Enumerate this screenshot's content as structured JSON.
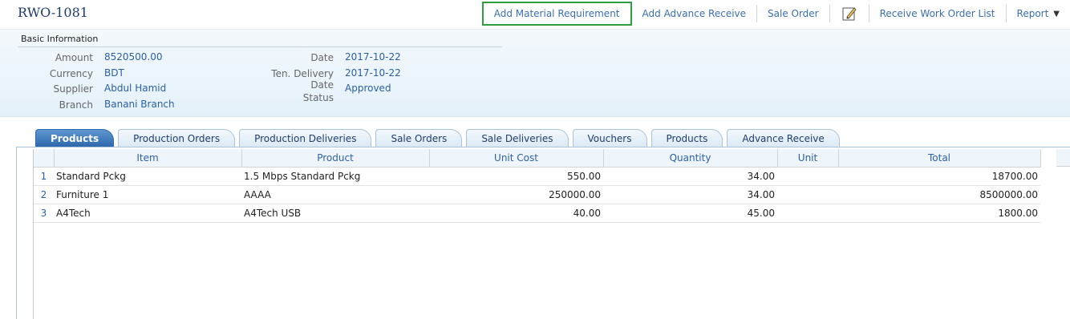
{
  "header": {
    "title": "RWO-1081",
    "toolbar": [
      {
        "label": "Add Material Requirement"
      },
      {
        "label": "Add Advance Receive"
      },
      {
        "label": "Sale Order"
      },
      {
        "label": "Receive Work Order List"
      },
      {
        "label": "Report"
      }
    ],
    "edit_icon": "edit-pencil-icon",
    "highlight_color": "#2e9e40"
  },
  "basic_info": {
    "heading": "Basic Information",
    "amount_label": "Amount",
    "amount": "8520500.00",
    "currency_label": "Currency",
    "currency": "BDT",
    "supplier_label": "Supplier",
    "supplier": "Abdul Hamid",
    "branch_label": "Branch",
    "branch": "Banani Branch",
    "date_label": "Date",
    "date": "2017-10-22",
    "ten_delivery_label": "Ten. Delivery",
    "ten_delivery": "2017-10-22",
    "date2_label": "Date",
    "status_label": "Status",
    "status": "Approved"
  },
  "tabs": [
    {
      "label": "Products",
      "active": true
    },
    {
      "label": "Production Orders"
    },
    {
      "label": "Production Deliveries"
    },
    {
      "label": "Sale Orders"
    },
    {
      "label": "Sale Deliveries"
    },
    {
      "label": "Vouchers"
    },
    {
      "label": "Products"
    },
    {
      "label": "Advance Receive"
    }
  ],
  "grid": {
    "columns": [
      "Item",
      "Product",
      "Unit Cost",
      "Quantity",
      "Unit",
      "Total"
    ],
    "rows": [
      {
        "n": "1",
        "item": "Standard Pckg",
        "product": "1.5 Mbps Standard Pckg",
        "unit_cost": "550.00",
        "quantity": "34.00",
        "unit": "",
        "total": "18700.00"
      },
      {
        "n": "2",
        "item": "Furniture 1",
        "product": "AAAA",
        "unit_cost": "250000.00",
        "quantity": "34.00",
        "unit": "",
        "total": "8500000.00"
      },
      {
        "n": "3",
        "item": "A4Tech",
        "product": "A4Tech USB",
        "unit_cost": "40.00",
        "quantity": "45.00",
        "unit": "",
        "total": "1800.00"
      }
    ]
  }
}
